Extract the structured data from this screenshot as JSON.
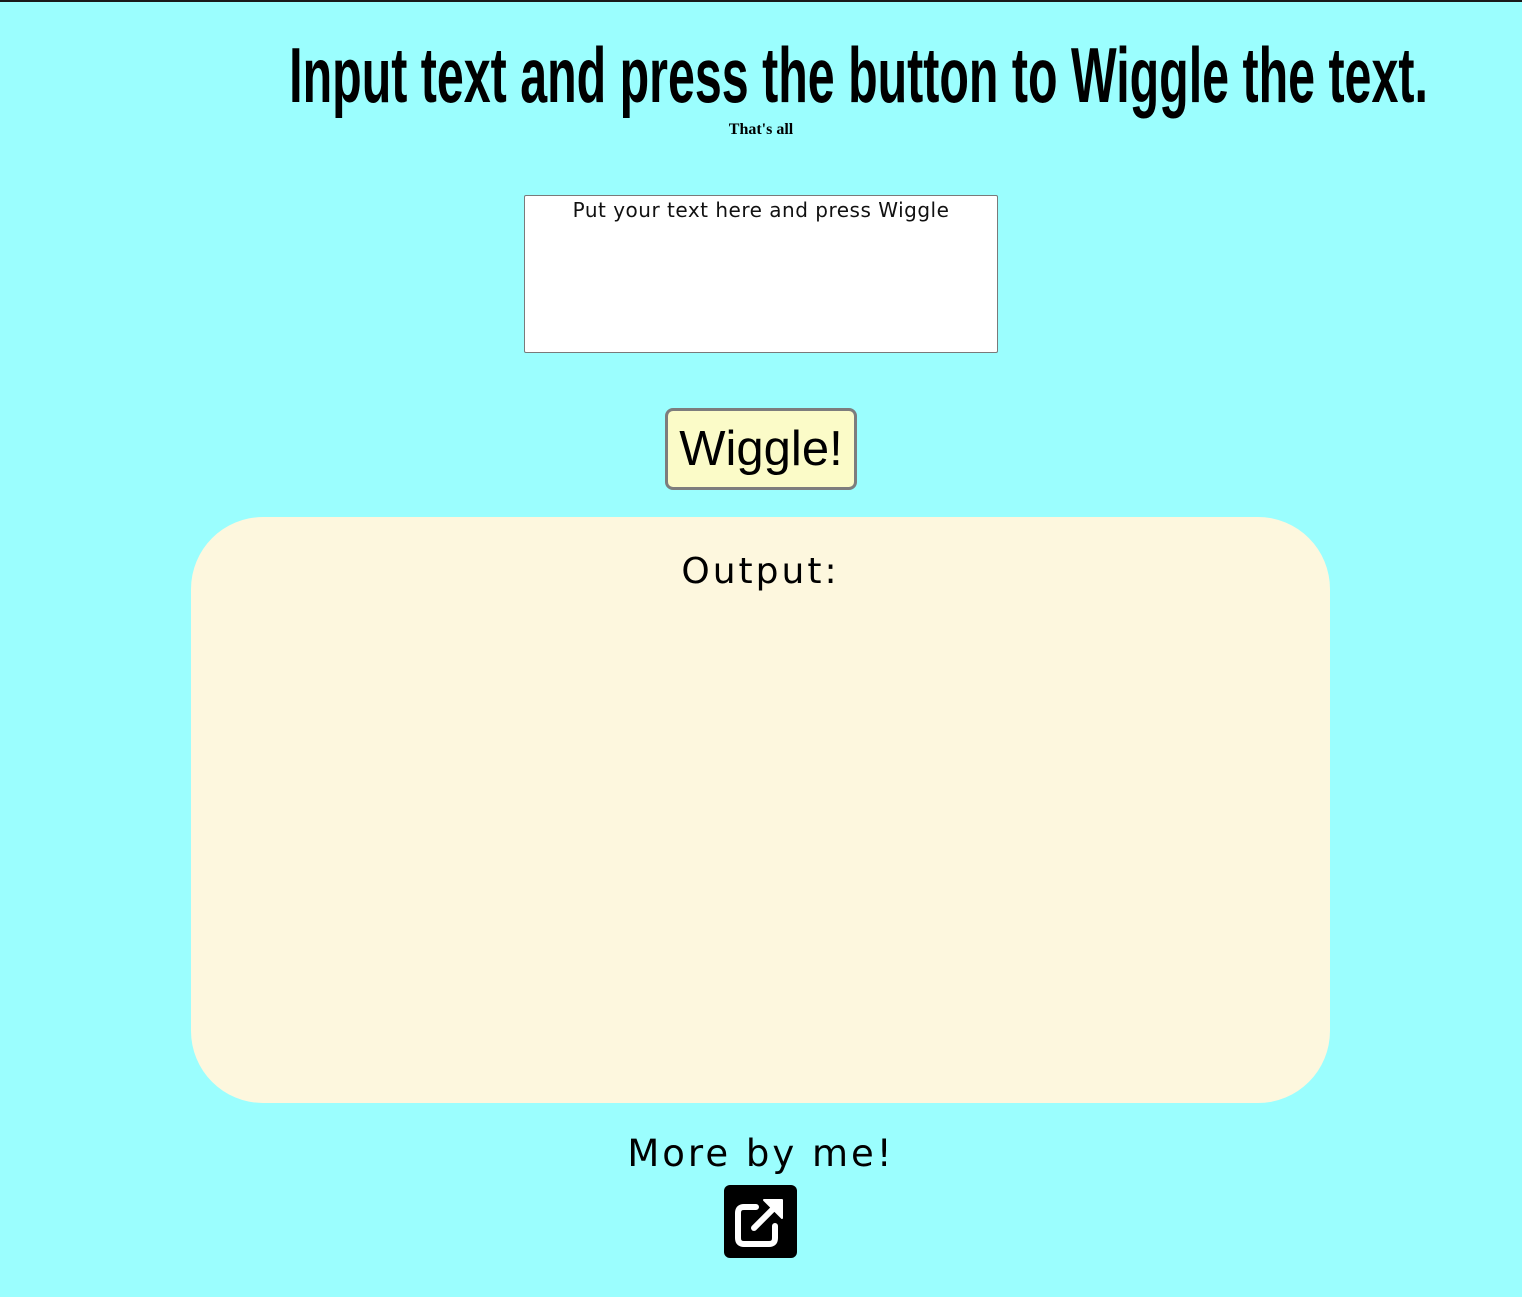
{
  "header": {
    "title": "Input text and press the button to Wiggle the text.",
    "subtitle": "That's all"
  },
  "input": {
    "placeholder": "Put your text here and press Wiggle",
    "value": ""
  },
  "wiggle_button": {
    "label": "Wiggle!"
  },
  "output": {
    "label": "Output:",
    "text": ""
  },
  "footer": {
    "more_label": "More by me!",
    "link_icon": "external-link-icon"
  },
  "colors": {
    "background": "#9bfefe",
    "button_bg": "#fbfbc8",
    "output_bg": "#fdf7de",
    "icon_bg": "#000000"
  }
}
